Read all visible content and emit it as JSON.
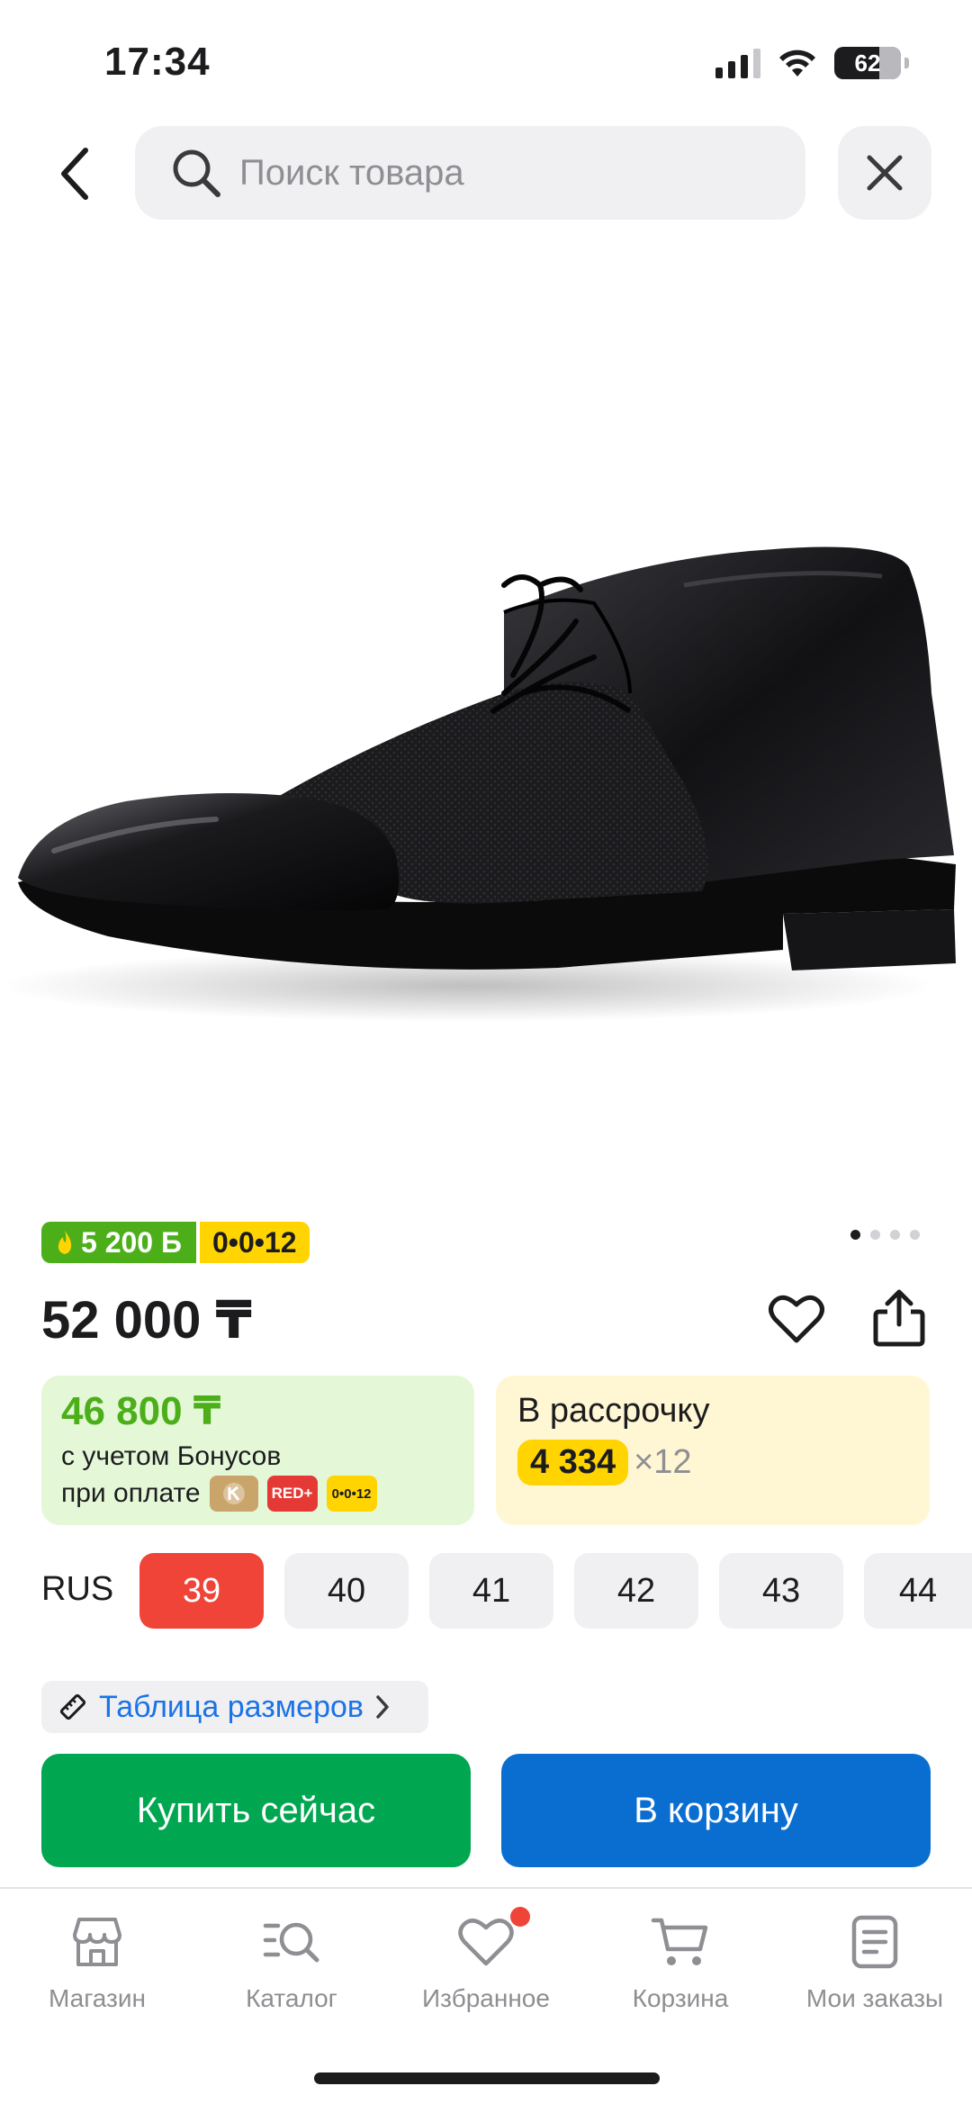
{
  "status_bar": {
    "time": "17:34",
    "battery": "62",
    "icons": [
      "signal-icon",
      "wifi-icon",
      "battery-icon"
    ]
  },
  "search": {
    "placeholder": "Поиск товара",
    "value": ""
  },
  "gallery": {
    "image": "black-leather-derby-shoe",
    "pages": 4,
    "current_page": 1
  },
  "badges": {
    "bonus": "5 200 Б",
    "installment": "0•0•12"
  },
  "price": "52 000 ₸",
  "bonus_card": {
    "amount": "46 800 ₸",
    "line1": "с учетом Бонусов",
    "line2": "при оплате",
    "chips": [
      "RED+",
      "0•0•12"
    ]
  },
  "installment_card": {
    "title": "В рассрочку",
    "monthly": "4 334",
    "multiplier": "×12"
  },
  "sizes": {
    "system": "RUS",
    "options": [
      "39",
      "40",
      "41",
      "42",
      "43",
      "44"
    ],
    "selected": "39"
  },
  "size_table_label": "Таблица размеров",
  "actions": {
    "buy_now": "Купить сейчас",
    "add_to_cart": "В корзину"
  },
  "tab_bar": {
    "items": [
      {
        "label": "Магазин",
        "icon": "store-icon"
      },
      {
        "label": "Каталог",
        "icon": "catalog-search-icon"
      },
      {
        "label": "Избранное",
        "icon": "heart-icon"
      },
      {
        "label": "Корзина",
        "icon": "cart-icon"
      },
      {
        "label": "Мои заказы",
        "icon": "orders-icon"
      }
    ]
  },
  "colors": {
    "accent_green": "#00a650",
    "accent_blue": "#0a6ed1",
    "selected_size": "#f04438",
    "bonus_green": "#4caf1a",
    "installment_yellow": "#ffd400"
  }
}
